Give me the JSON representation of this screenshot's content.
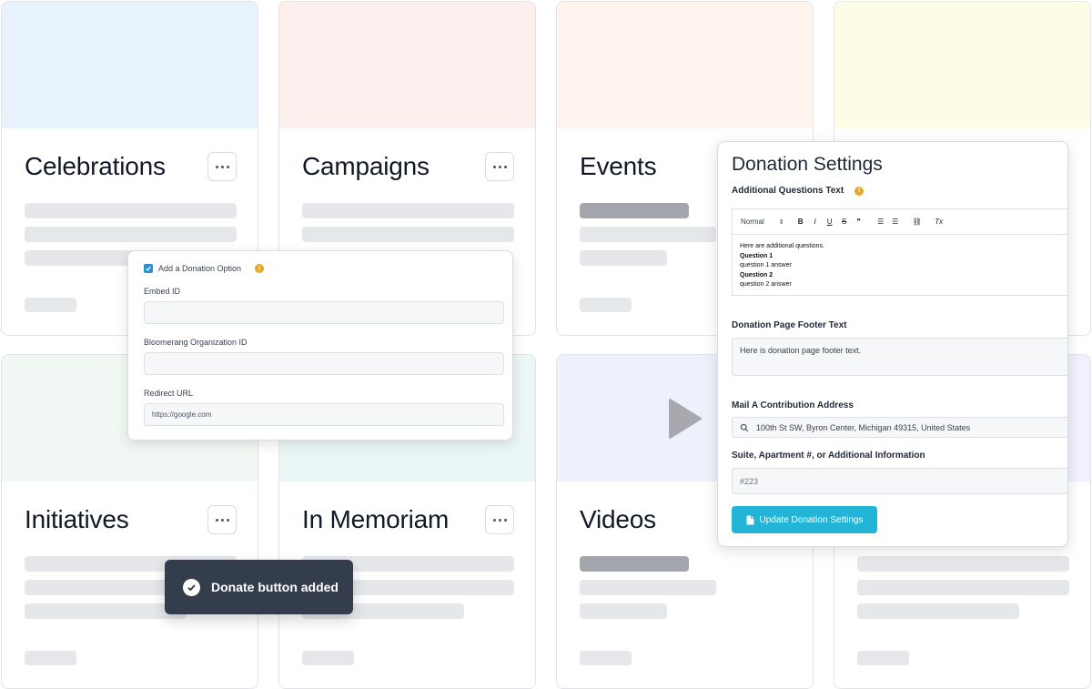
{
  "cards": [
    {
      "title": "Celebrations",
      "banner_color": "#e8f2fd"
    },
    {
      "title": "Campaigns",
      "banner_color": "#fcefee"
    },
    {
      "title": "Events",
      "banner_color": "#fff4ee"
    },
    {
      "title": "",
      "banner_color": "#fdfde7"
    },
    {
      "title": "Initiatives",
      "banner_color": "#f1f8f4"
    },
    {
      "title": "In Memoriam",
      "banner_color": "#eaf7f6"
    },
    {
      "title": "Videos",
      "banner_color": "#eef0fc"
    },
    {
      "title": "",
      "banner_color": "#f3f0fd"
    }
  ],
  "donation_option_popup": {
    "checkbox_label": "Add a Donation Option",
    "info_icon": "!",
    "embed_id_label": "Embed ID",
    "embed_id_value": "",
    "org_id_label": "Bloomerang Organization ID",
    "org_id_value": "",
    "redirect_url_label": "Redirect URL",
    "redirect_url_value": "https://google.com"
  },
  "donation_settings": {
    "title": "Donation Settings",
    "additional_questions_label": "Additional Questions Text",
    "info_icon": "!",
    "toolbar": {
      "format": "Normal",
      "bold": "B",
      "italic": "I",
      "underline": "U",
      "strike": "S",
      "quote": "❞",
      "clear": "Tx"
    },
    "editor_lines": [
      {
        "text": "Here are additional questions.",
        "bold": false
      },
      {
        "text": "Question 1",
        "bold": true
      },
      {
        "text": "question 1 answer",
        "bold": false
      },
      {
        "text": "Question 2",
        "bold": true
      },
      {
        "text": "question 2 answer",
        "bold": false
      }
    ],
    "footer_label": "Donation Page Footer Text",
    "footer_value": "Here is donation page footer text.",
    "address_label": "Mail A Contribution Address",
    "address_value": "100th St SW, Byron Center, Michigan 49315, United States",
    "suite_label": "Suite, Apartment #, or Additional Information",
    "suite_placeholder": "#223",
    "update_button": "Update Donation Settings"
  },
  "toast": {
    "message": "Donate button added"
  },
  "colors": {
    "accent": "#22b5d8",
    "checkbox": "#2b8fc9",
    "info": "#e5a823",
    "toast_bg": "#343d4b"
  }
}
